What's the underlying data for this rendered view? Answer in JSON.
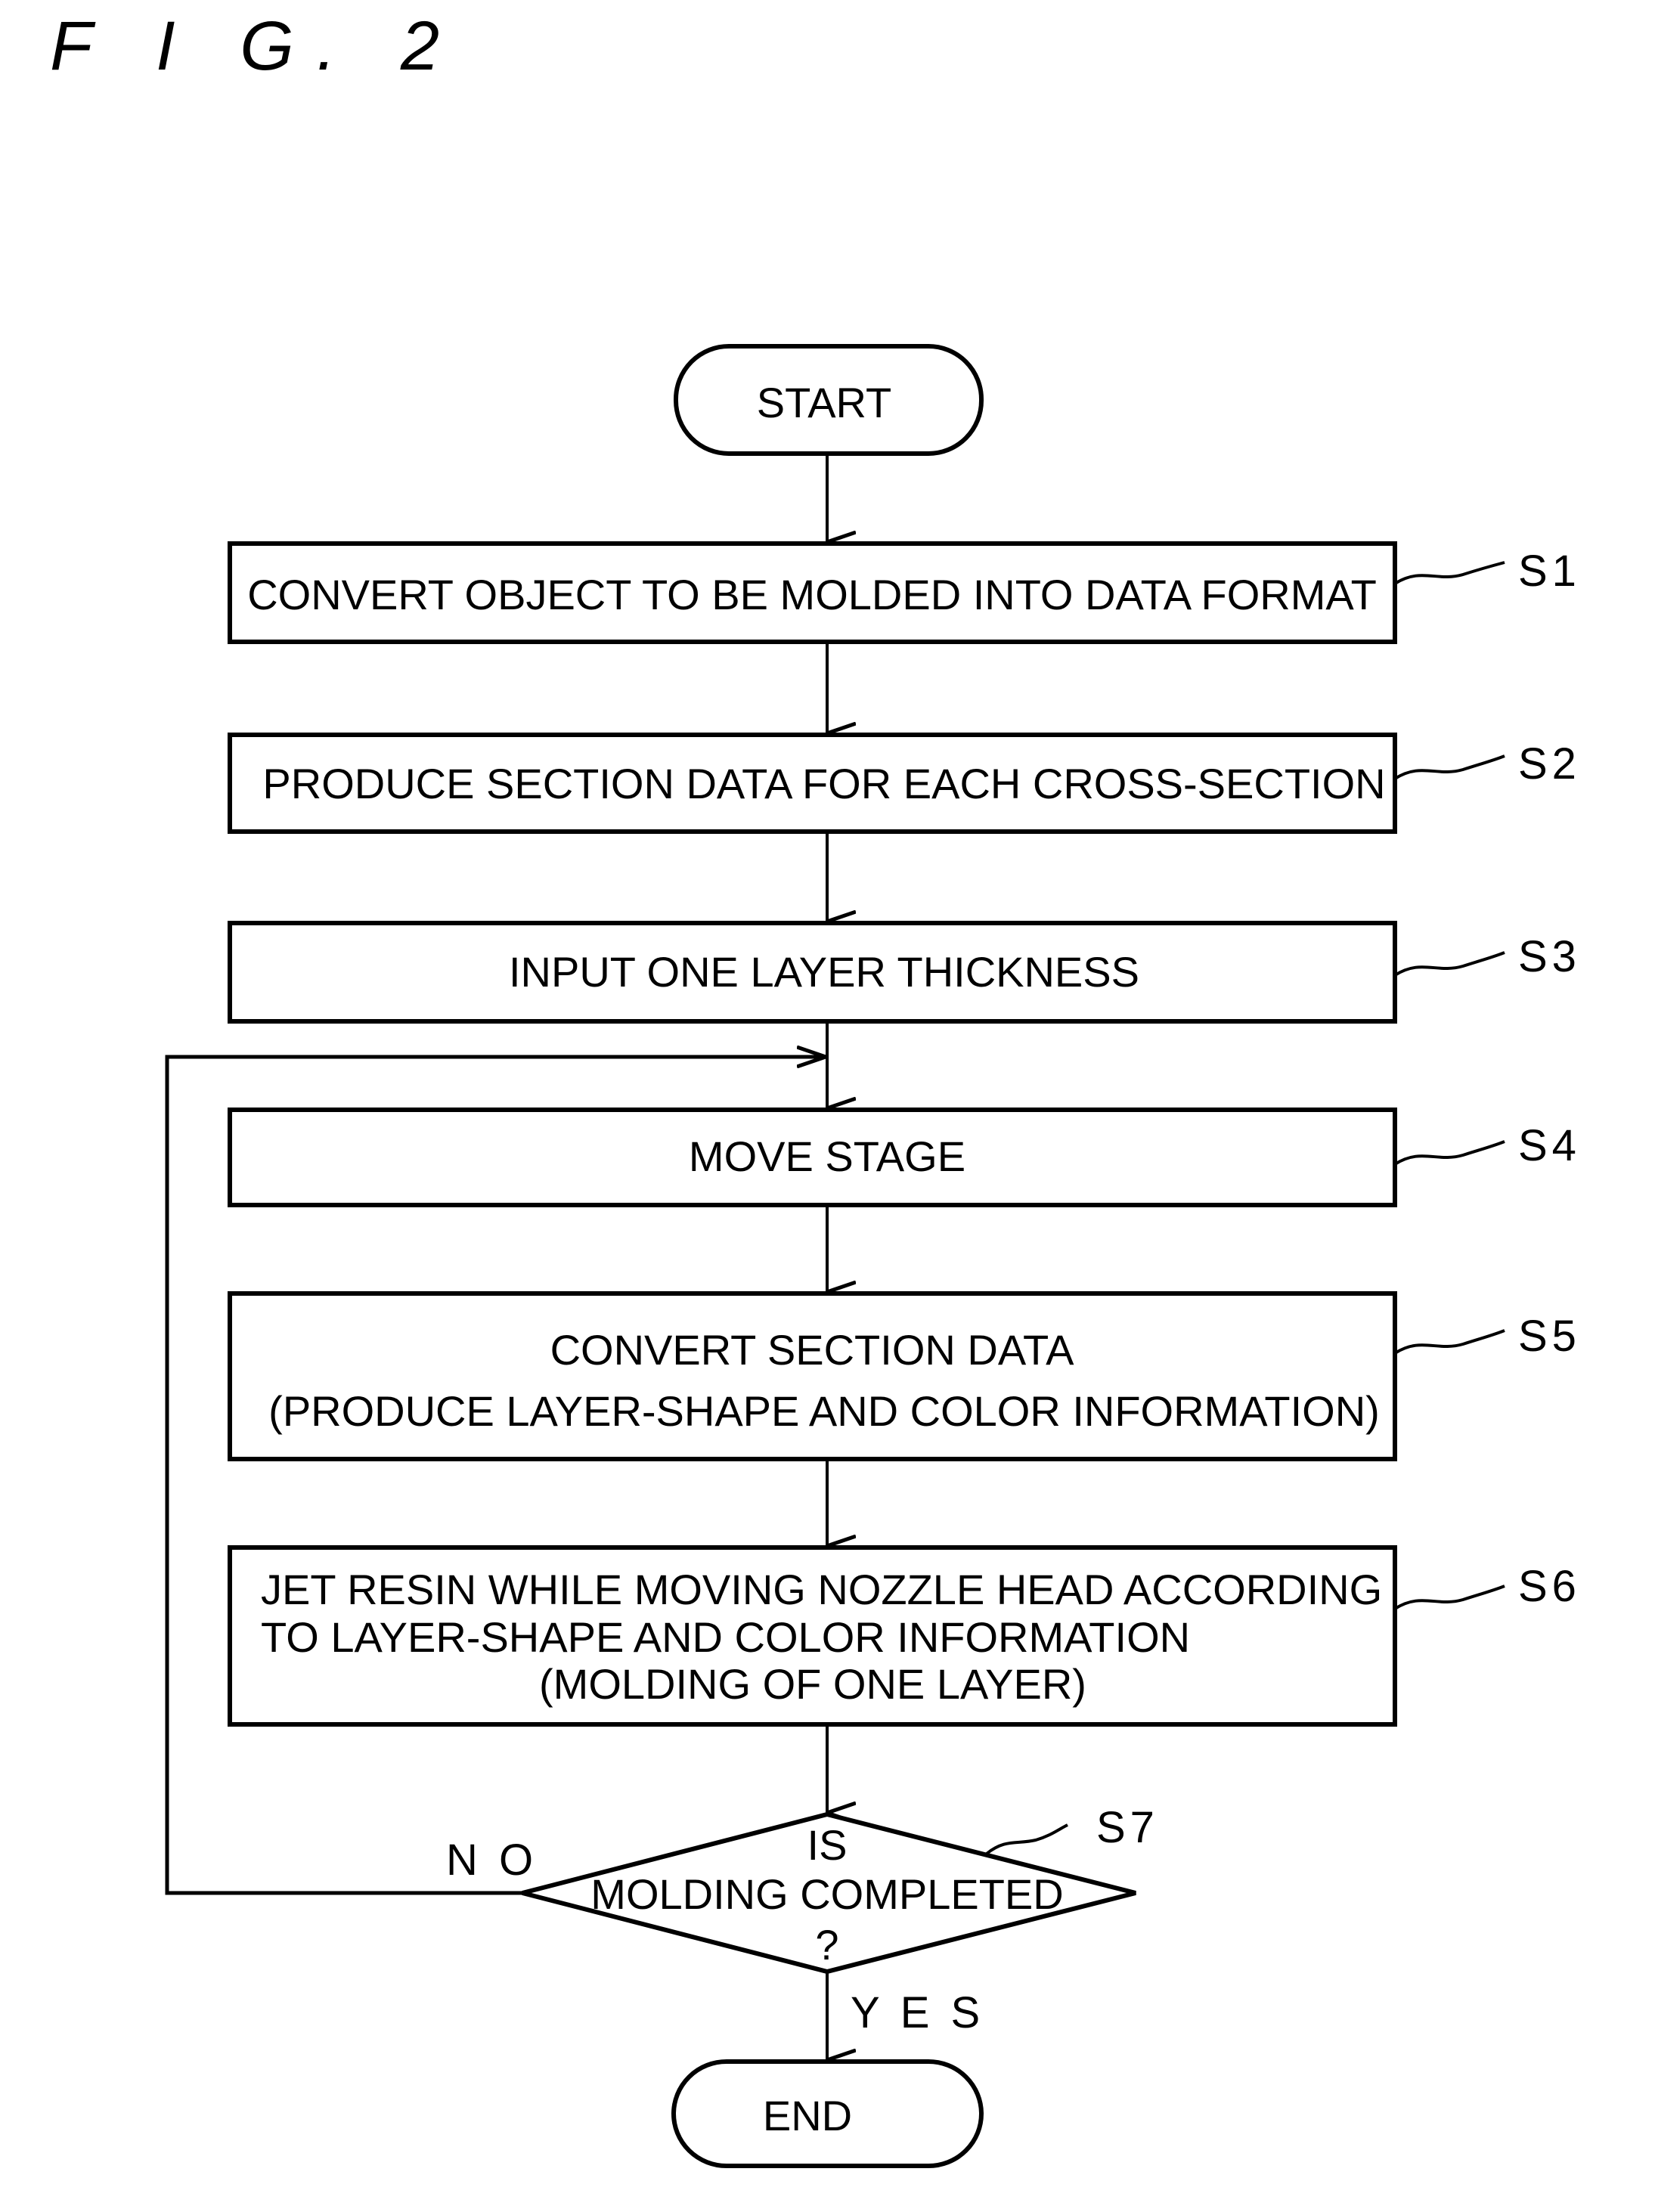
{
  "figure_label": "F I G. 2",
  "terminals": {
    "start": "START",
    "end": "END"
  },
  "steps": [
    {
      "id": "S1",
      "lines": [
        "CONVERT OBJECT TO BE MOLDED INTO DATA FORMAT"
      ]
    },
    {
      "id": "S2",
      "lines": [
        "PRODUCE SECTION DATA FOR EACH CROSS-SECTION"
      ]
    },
    {
      "id": "S3",
      "lines": [
        "INPUT ONE LAYER THICKNESS"
      ]
    },
    {
      "id": "S4",
      "lines": [
        "MOVE STAGE"
      ]
    },
    {
      "id": "S5",
      "lines": [
        "CONVERT SECTION DATA",
        "(PRODUCE LAYER-SHAPE AND COLOR INFORMATION)"
      ]
    },
    {
      "id": "S6",
      "lines": [
        "JET RESIN WHILE MOVING NOZZLE HEAD ACCORDING",
        "TO LAYER-SHAPE AND COLOR INFORMATION",
        "(MOLDING OF ONE LAYER)"
      ]
    }
  ],
  "decision": {
    "id": "S7",
    "lines": [
      "IS",
      "MOLDING COMPLETED",
      "?"
    ],
    "no_label": "N O",
    "yes_label": "Y E S"
  }
}
